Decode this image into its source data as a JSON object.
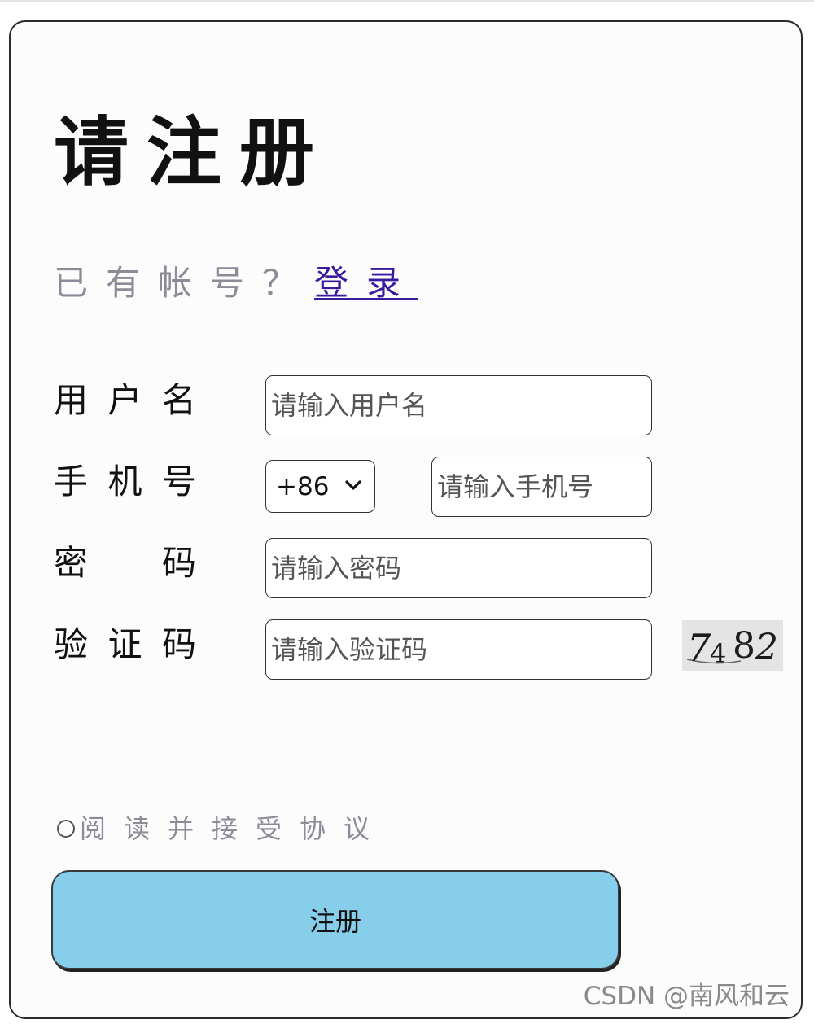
{
  "title": "请注册",
  "login_prompt": {
    "text": "已有帐号？",
    "link_label": "登录"
  },
  "fields": {
    "username": {
      "label": [
        "用",
        "户",
        "名"
      ],
      "placeholder": "请输入用户名"
    },
    "phone": {
      "label": [
        "手",
        "机",
        "号"
      ],
      "country_code": "+86",
      "placeholder": "请输入手机号"
    },
    "password": {
      "label": [
        "密",
        "码"
      ],
      "placeholder": "请输入密码"
    },
    "captcha": {
      "label": [
        "验",
        "证",
        "码"
      ],
      "placeholder": "请输入验证码",
      "image_text": "7482"
    }
  },
  "agreement": {
    "checked": false,
    "text": "阅读并接受协议"
  },
  "register_button": "注册",
  "watermark": "CSDN @南风和云",
  "colors": {
    "button_bg": "#87ceeb",
    "link": "#3c1a9e",
    "muted_text": "#8c8c98"
  }
}
